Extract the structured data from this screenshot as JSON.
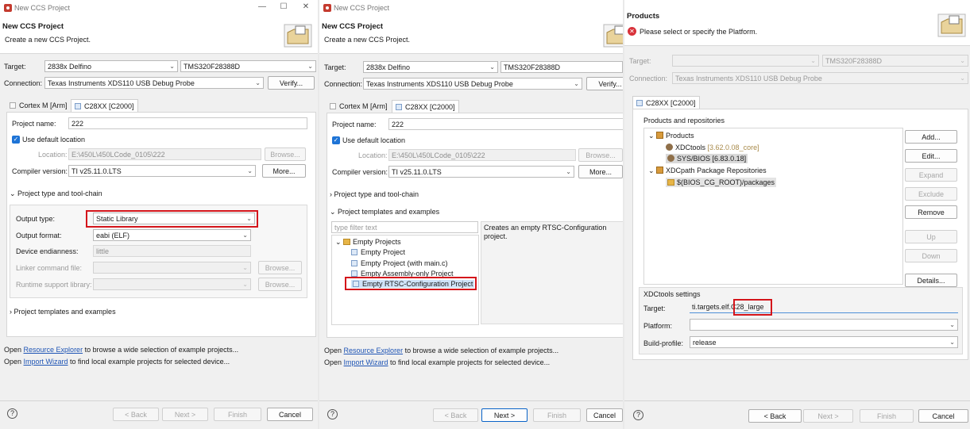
{
  "window_title": "New CCS Project",
  "window_controls": {
    "minimize": "—",
    "maximize": "☐",
    "close": "✕"
  },
  "header": {
    "title": "New CCS Project",
    "subtitle": "Create a new CCS Project."
  },
  "target": {
    "label": "Target:",
    "family": "2838x Delfino",
    "device": "TMS320F28388D"
  },
  "connection": {
    "label": "Connection:",
    "value": "Texas Instruments XDS110 USB Debug Probe",
    "verify": "Verify..."
  },
  "tabs": {
    "arm": "Cortex M [Arm]",
    "c2000": "C28XX [C2000]"
  },
  "project": {
    "name_label": "Project name:",
    "name": "222",
    "use_default": "Use default location",
    "location_label": "Location:",
    "location": "E:\\450L\\450LCode_0105\\222",
    "browse": "Browse...",
    "compiler_label": "Compiler version:",
    "compiler": "TI v25.11.0.LTS",
    "more": "More..."
  },
  "toolchain": {
    "section": "Project type and tool-chain",
    "output_type_label": "Output type:",
    "output_type": "Static Library",
    "output_format_label": "Output format:",
    "output_format": "eabi (ELF)",
    "endianness_label": "Device endianness:",
    "endianness": "little",
    "linker_label": "Linker command file:",
    "runtime_label": "Runtime support library:",
    "browse": "Browse..."
  },
  "templates": {
    "section": "Project templates and examples",
    "filter_placeholder": "type filter text",
    "group": "Empty Projects",
    "items": [
      "Empty Project",
      "Empty Project (with main.c)",
      "Empty Assembly-only Project",
      "Empty RTSC-Configuration Project"
    ],
    "description": "Creates an empty RTSC-Configuration project."
  },
  "footer": {
    "line1_pre": "Open ",
    "line1_link": "Resource Explorer",
    "line1_post": " to browse a wide selection of example projects...",
    "line2_pre": "Open ",
    "line2_link": "Import Wizard",
    "line2_post": " to find local example projects for selected device..."
  },
  "nav": {
    "help": "?",
    "back": "< Back",
    "next": "Next >",
    "finish": "Finish",
    "cancel": "Cancel"
  },
  "products_page": {
    "title": "Products",
    "error": "Please select or specify the Platform.",
    "error_icon": "✕",
    "group_label": "Products and repositories",
    "tree": {
      "products": "Products",
      "xdctools": "XDCtools",
      "xdctools_ver": "[3.62.0.08_core]",
      "sysbios": "SYS/BIOS",
      "sysbios_ver": "[6.83.0.18]",
      "repos": "XDCpath Package Repositories",
      "repo_path": "$(BIOS_CG_ROOT)/packages"
    },
    "buttons": {
      "add": "Add...",
      "edit": "Edit...",
      "expand": "Expand",
      "exclude": "Exclude",
      "remove": "Remove",
      "up": "Up",
      "down": "Down",
      "details": "Details..."
    },
    "xdc": {
      "label": "XDCtools settings",
      "target_label": "Target:",
      "target_prefix": "ti.targets.elf.",
      "target_suffix": "C28_large",
      "platform_label": "Platform:",
      "platform": "",
      "profile_label": "Build-profile:",
      "profile": "release"
    }
  },
  "colors": {
    "highlight_box": "#d4151b",
    "link": "#1f55b5",
    "checkbox": "#1e74d6"
  }
}
